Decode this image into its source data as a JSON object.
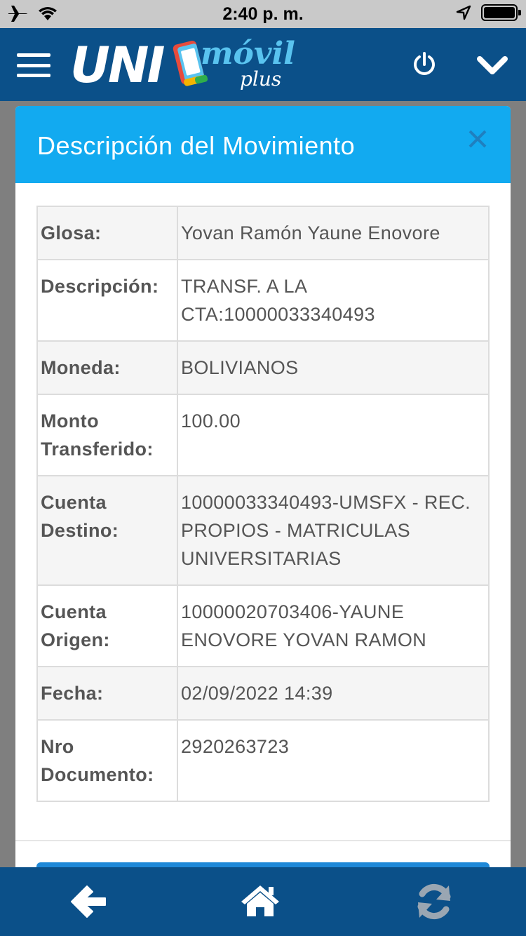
{
  "status_bar": {
    "time": "2:40 p. m.",
    "icons": [
      "airplane-icon",
      "wifi-icon",
      "location-arrow-icon",
      "battery-icon"
    ]
  },
  "header": {
    "logo": {
      "main": "UNI",
      "movil": "móvil",
      "plus": "plus"
    },
    "icons": [
      "menu-icon",
      "power-icon",
      "chevron-down-icon"
    ]
  },
  "modal": {
    "title": "Descripción del Movimiento",
    "close_icon": "close-icon",
    "rows": [
      {
        "label": "Glosa:",
        "value": "Yovan Ramón Yaune Enovore"
      },
      {
        "label": "Descripción:",
        "value": "TRANSF. A LA CTA:10000033340493"
      },
      {
        "label": "Moneda:",
        "value": "BOLIVIANOS"
      },
      {
        "label": "Monto Transferido:",
        "value": "100.00"
      },
      {
        "label": "Cuenta Destino:",
        "value": "10000033340493-UMSFX - REC. PROPIOS - MATRICULAS UNIVERSITARIAS"
      },
      {
        "label": "Cuenta Origen:",
        "value": "10000020703406-YAUNE ENOVORE YOVAN RAMON"
      },
      {
        "label": "Fecha:",
        "value": "02/09/2022 14:39"
      },
      {
        "label": "Nro Documento:",
        "value": "2920263723"
      }
    ]
  },
  "bottom_nav": {
    "icons": [
      "back-arrow-icon",
      "home-icon",
      "refresh-icon"
    ]
  },
  "colors": {
    "header_bg": "#0b5089",
    "modal_header_bg": "#12aaf0",
    "text": "#555555"
  }
}
